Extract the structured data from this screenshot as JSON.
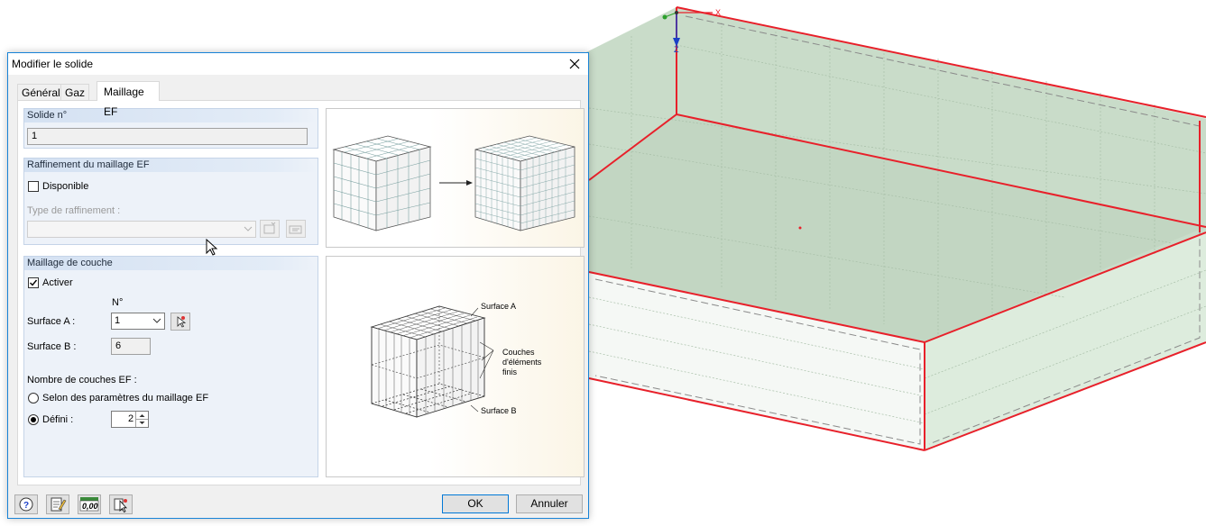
{
  "dialog": {
    "title": "Modifier le solide",
    "tabs": [
      {
        "label": "Général"
      },
      {
        "label": "Gaz"
      },
      {
        "label": "Maillage EF"
      }
    ],
    "solide": {
      "header": "Solide n°",
      "value": "1"
    },
    "raffinement": {
      "header": "Raffinement du maillage EF",
      "disponible_label": "Disponible",
      "disponible_checked": false,
      "type_label": "Type de raffinement :",
      "type_value": ""
    },
    "couche": {
      "header": "Maillage de couche",
      "activer_label": "Activer",
      "activer_checked": true,
      "n_header": "N°",
      "surface_a_label": "Surface A :",
      "surface_a_value": "1",
      "surface_b_label": "Surface B :",
      "surface_b_value": "6",
      "nombre_label": "Nombre de couches EF :",
      "option_selon": "Selon des paramètres du maillage EF",
      "option_defini": "Défini :",
      "defini_value": "2"
    },
    "illustration": {
      "surface_a": "Surface A",
      "couches_line1": "Couches",
      "couches_line2": "d'éléments",
      "couches_line3": "finis",
      "surface_b": "Surface B"
    },
    "buttons": {
      "ok": "OK",
      "cancel": "Annuler",
      "units_value": "0,00"
    }
  },
  "viewport": {
    "axis_x": "X",
    "axis_z": "Z"
  },
  "colors": {
    "accent": "#0078d7",
    "edge_red": "#e8202a",
    "solid_fill": "#c9dcc9"
  }
}
